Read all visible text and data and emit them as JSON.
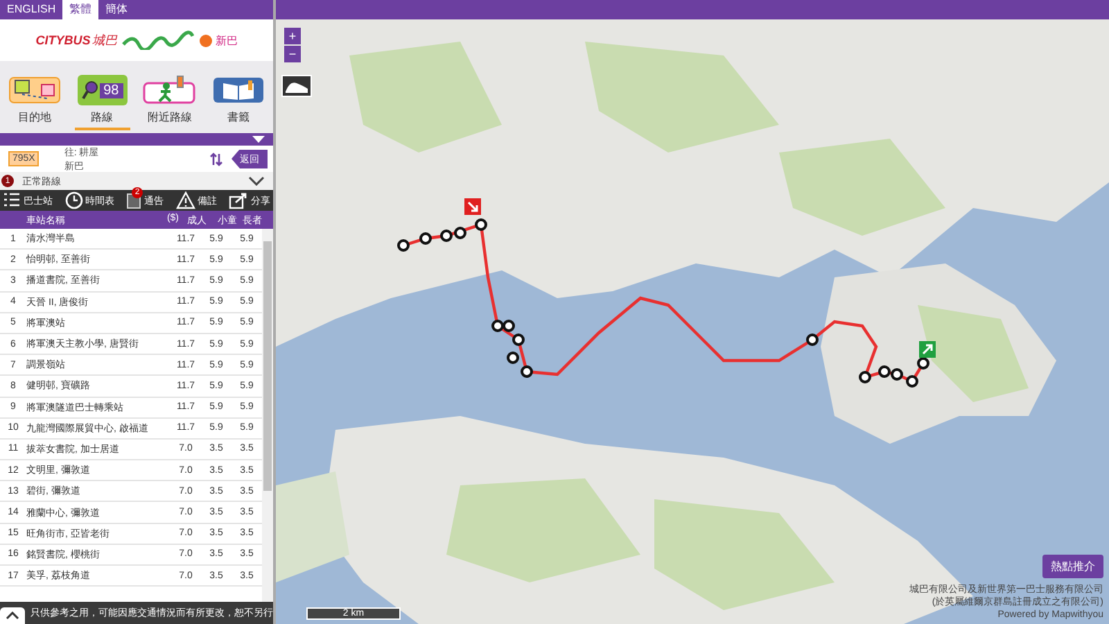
{
  "languages": [
    {
      "label": "ENGLISH",
      "selected": false
    },
    {
      "label": "繁體",
      "selected": true
    },
    {
      "label": "簡体",
      "selected": false
    }
  ],
  "logos": {
    "citybus": "CITYBUS",
    "citybus_zh": "城巴",
    "nwfb": "新巴"
  },
  "nav": [
    {
      "label": "目的地",
      "kind": "destination",
      "selected": false
    },
    {
      "label": "路線",
      "kind": "route",
      "selected": true,
      "icon_text": "98"
    },
    {
      "label": "附近路線",
      "kind": "nearby",
      "selected": false
    },
    {
      "label": "書籤",
      "kind": "bookmark",
      "selected": false
    }
  ],
  "route": {
    "number": "795X",
    "destination": "往: 耕屋",
    "operator": "新巴",
    "back_button": "返回"
  },
  "variant": {
    "badge": "1",
    "label": "正常路線",
    "expanded": false
  },
  "toolbar": [
    {
      "label": "巴士站",
      "kind": "stops"
    },
    {
      "label": "時間表",
      "kind": "timetable"
    },
    {
      "label": "通告",
      "kind": "notice",
      "badge": "2"
    },
    {
      "label": "備註",
      "kind": "remarks"
    },
    {
      "label": "分享",
      "kind": "share"
    }
  ],
  "table": {
    "columns": [
      "",
      "車站名稱",
      "成人",
      "小童",
      "長者"
    ],
    "currency_note": "($)",
    "rows": [
      [
        "1",
        "清水灣半島",
        "11.7",
        "5.9",
        "5.9"
      ],
      [
        "2",
        "怡明邨, 至善街",
        "11.7",
        "5.9",
        "5.9"
      ],
      [
        "3",
        "播道書院, 至善街",
        "11.7",
        "5.9",
        "5.9"
      ],
      [
        "4",
        "天晉 II, 唐俊街",
        "11.7",
        "5.9",
        "5.9"
      ],
      [
        "5",
        "將軍澳站",
        "11.7",
        "5.9",
        "5.9"
      ],
      [
        "6",
        "將軍澳天主教小學, 唐賢街",
        "11.7",
        "5.9",
        "5.9"
      ],
      [
        "7",
        "調景嶺站",
        "11.7",
        "5.9",
        "5.9"
      ],
      [
        "8",
        "健明邨, 寶礦路",
        "11.7",
        "5.9",
        "5.9"
      ],
      [
        "9",
        "將軍澳隧道巴士轉乘站",
        "11.7",
        "5.9",
        "5.9"
      ],
      [
        "10",
        "九龍灣國際展貿中心, 啟福道",
        "11.7",
        "5.9",
        "5.9"
      ],
      [
        "11",
        "拔萃女書院, 加士居道",
        "7.0",
        "3.5",
        "3.5"
      ],
      [
        "12",
        "文明里, 彌敦道",
        "7.0",
        "3.5",
        "3.5"
      ],
      [
        "13",
        "碧街, 彌敦道",
        "7.0",
        "3.5",
        "3.5"
      ],
      [
        "14",
        "雅蘭中心, 彌敦道",
        "7.0",
        "3.5",
        "3.5"
      ],
      [
        "15",
        "旺角街市, 亞皆老街",
        "7.0",
        "3.5",
        "3.5"
      ],
      [
        "16",
        "銘賢書院, 櫻桃街",
        "7.0",
        "3.5",
        "3.5"
      ],
      [
        "17",
        "美孚, 荔枝角道",
        "7.0",
        "3.5",
        "3.5"
      ]
    ]
  },
  "footer": {
    "note": "只供參考之用，可能因應交通情況而有所更改，恕不另行"
  },
  "map": {
    "zoom_in": "+",
    "zoom_out": "−",
    "scale": "2 km",
    "hotspot_button": "熱點推介",
    "attribution": [
      "城巴有限公司及新世界第一巴士服務有限公司",
      "(於英屬維爾京群島註冊成立之有限公司)"
    ],
    "powered_by": "Powered by Mapwithyou"
  }
}
